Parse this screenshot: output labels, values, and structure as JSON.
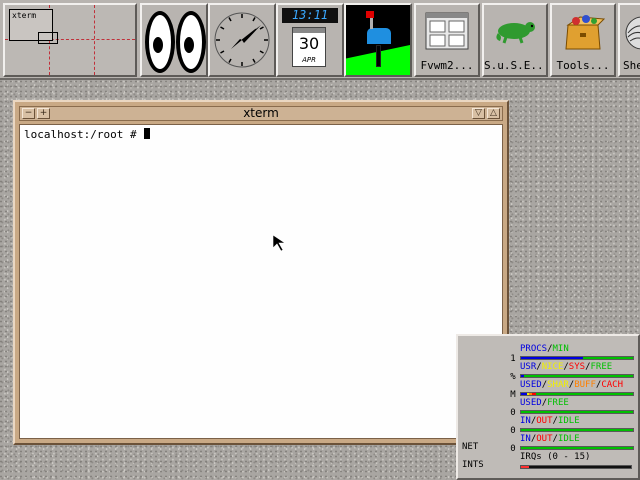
{
  "buttonbar": {
    "pager": {
      "mini_window_label": "xterm"
    },
    "calendar": {
      "time": "13:11",
      "day": "30",
      "month": "APR"
    },
    "buttons": [
      {
        "label": "Fvwm2...",
        "icon": "window-panes-icon"
      },
      {
        "label": "S.u.S.E...",
        "icon": "chameleon-icon"
      },
      {
        "label": "Tools...",
        "icon": "toolbox-icon"
      },
      {
        "label": "She",
        "icon": "shell-icon"
      }
    ]
  },
  "xterm": {
    "title": "xterm",
    "prompt": "localhost:/root # ",
    "title_buttons": {
      "left1": "−",
      "left2": "+",
      "right1": "▽",
      "right2": "△"
    }
  },
  "xosview": {
    "left_labels": [
      "1",
      "%",
      "M",
      "0",
      "0",
      "0"
    ],
    "rows": [
      {
        "segments": [
          {
            "text": "PROCS",
            "color": "#0000e0"
          },
          {
            "text": "/",
            "color": "#000000"
          },
          {
            "text": "MIN",
            "color": "#00c000"
          }
        ],
        "fill": [
          {
            "color": "#0000e0",
            "fraction": 0.55
          }
        ]
      },
      {
        "segments": [
          {
            "text": "USR",
            "color": "#0000e0"
          },
          {
            "text": "/",
            "color": "#000000"
          },
          {
            "text": "NICE",
            "color": "#f0f000"
          },
          {
            "text": "/",
            "color": "#000000"
          },
          {
            "text": "SYS",
            "color": "#ff0000"
          },
          {
            "text": "/",
            "color": "#000000"
          },
          {
            "text": "FREE",
            "color": "#00c000"
          }
        ],
        "fill": [
          {
            "color": "#0000e0",
            "fraction": 0.03
          }
        ]
      },
      {
        "segments": [
          {
            "text": "USED",
            "color": "#0000e0"
          },
          {
            "text": "/",
            "color": "#000000"
          },
          {
            "text": "SHAR",
            "color": "#f0f000"
          },
          {
            "text": "/",
            "color": "#000000"
          },
          {
            "text": "BUFF",
            "color": "#ff8000"
          },
          {
            "text": "/",
            "color": "#000000"
          },
          {
            "text": "CACH",
            "color": "#ff0000"
          }
        ],
        "fill": [
          {
            "color": "#0000e0",
            "fraction": 0.05
          },
          {
            "color": "#f0f000",
            "fraction": 0.02
          },
          {
            "color": "#ff8000",
            "fraction": 0.03
          },
          {
            "color": "#ff0000",
            "fraction": 0.03
          }
        ]
      },
      {
        "segments": [
          {
            "text": "USED",
            "color": "#0000e0"
          },
          {
            "text": "/",
            "color": "#000000"
          },
          {
            "text": "FREE",
            "color": "#00c000"
          }
        ],
        "fill": []
      },
      {
        "segments": [
          {
            "text": "IN",
            "color": "#0000e0"
          },
          {
            "text": "/",
            "color": "#000000"
          },
          {
            "text": "OUT",
            "color": "#ff0000"
          },
          {
            "text": "/",
            "color": "#000000"
          },
          {
            "text": "IDLE",
            "color": "#00c000"
          }
        ],
        "fill": []
      },
      {
        "segments": [
          {
            "text": "IN",
            "color": "#0000e0"
          },
          {
            "text": "/",
            "color": "#000000"
          },
          {
            "text": "OUT",
            "color": "#ff0000"
          },
          {
            "text": "/",
            "color": "#000000"
          },
          {
            "text": "IDLE",
            "color": "#00c000"
          }
        ],
        "fill": []
      }
    ],
    "net_label": "NET",
    "ints_label": "INTS",
    "irq_title": "IRQs (0 - 15)",
    "irq_fraction": 0.07
  }
}
